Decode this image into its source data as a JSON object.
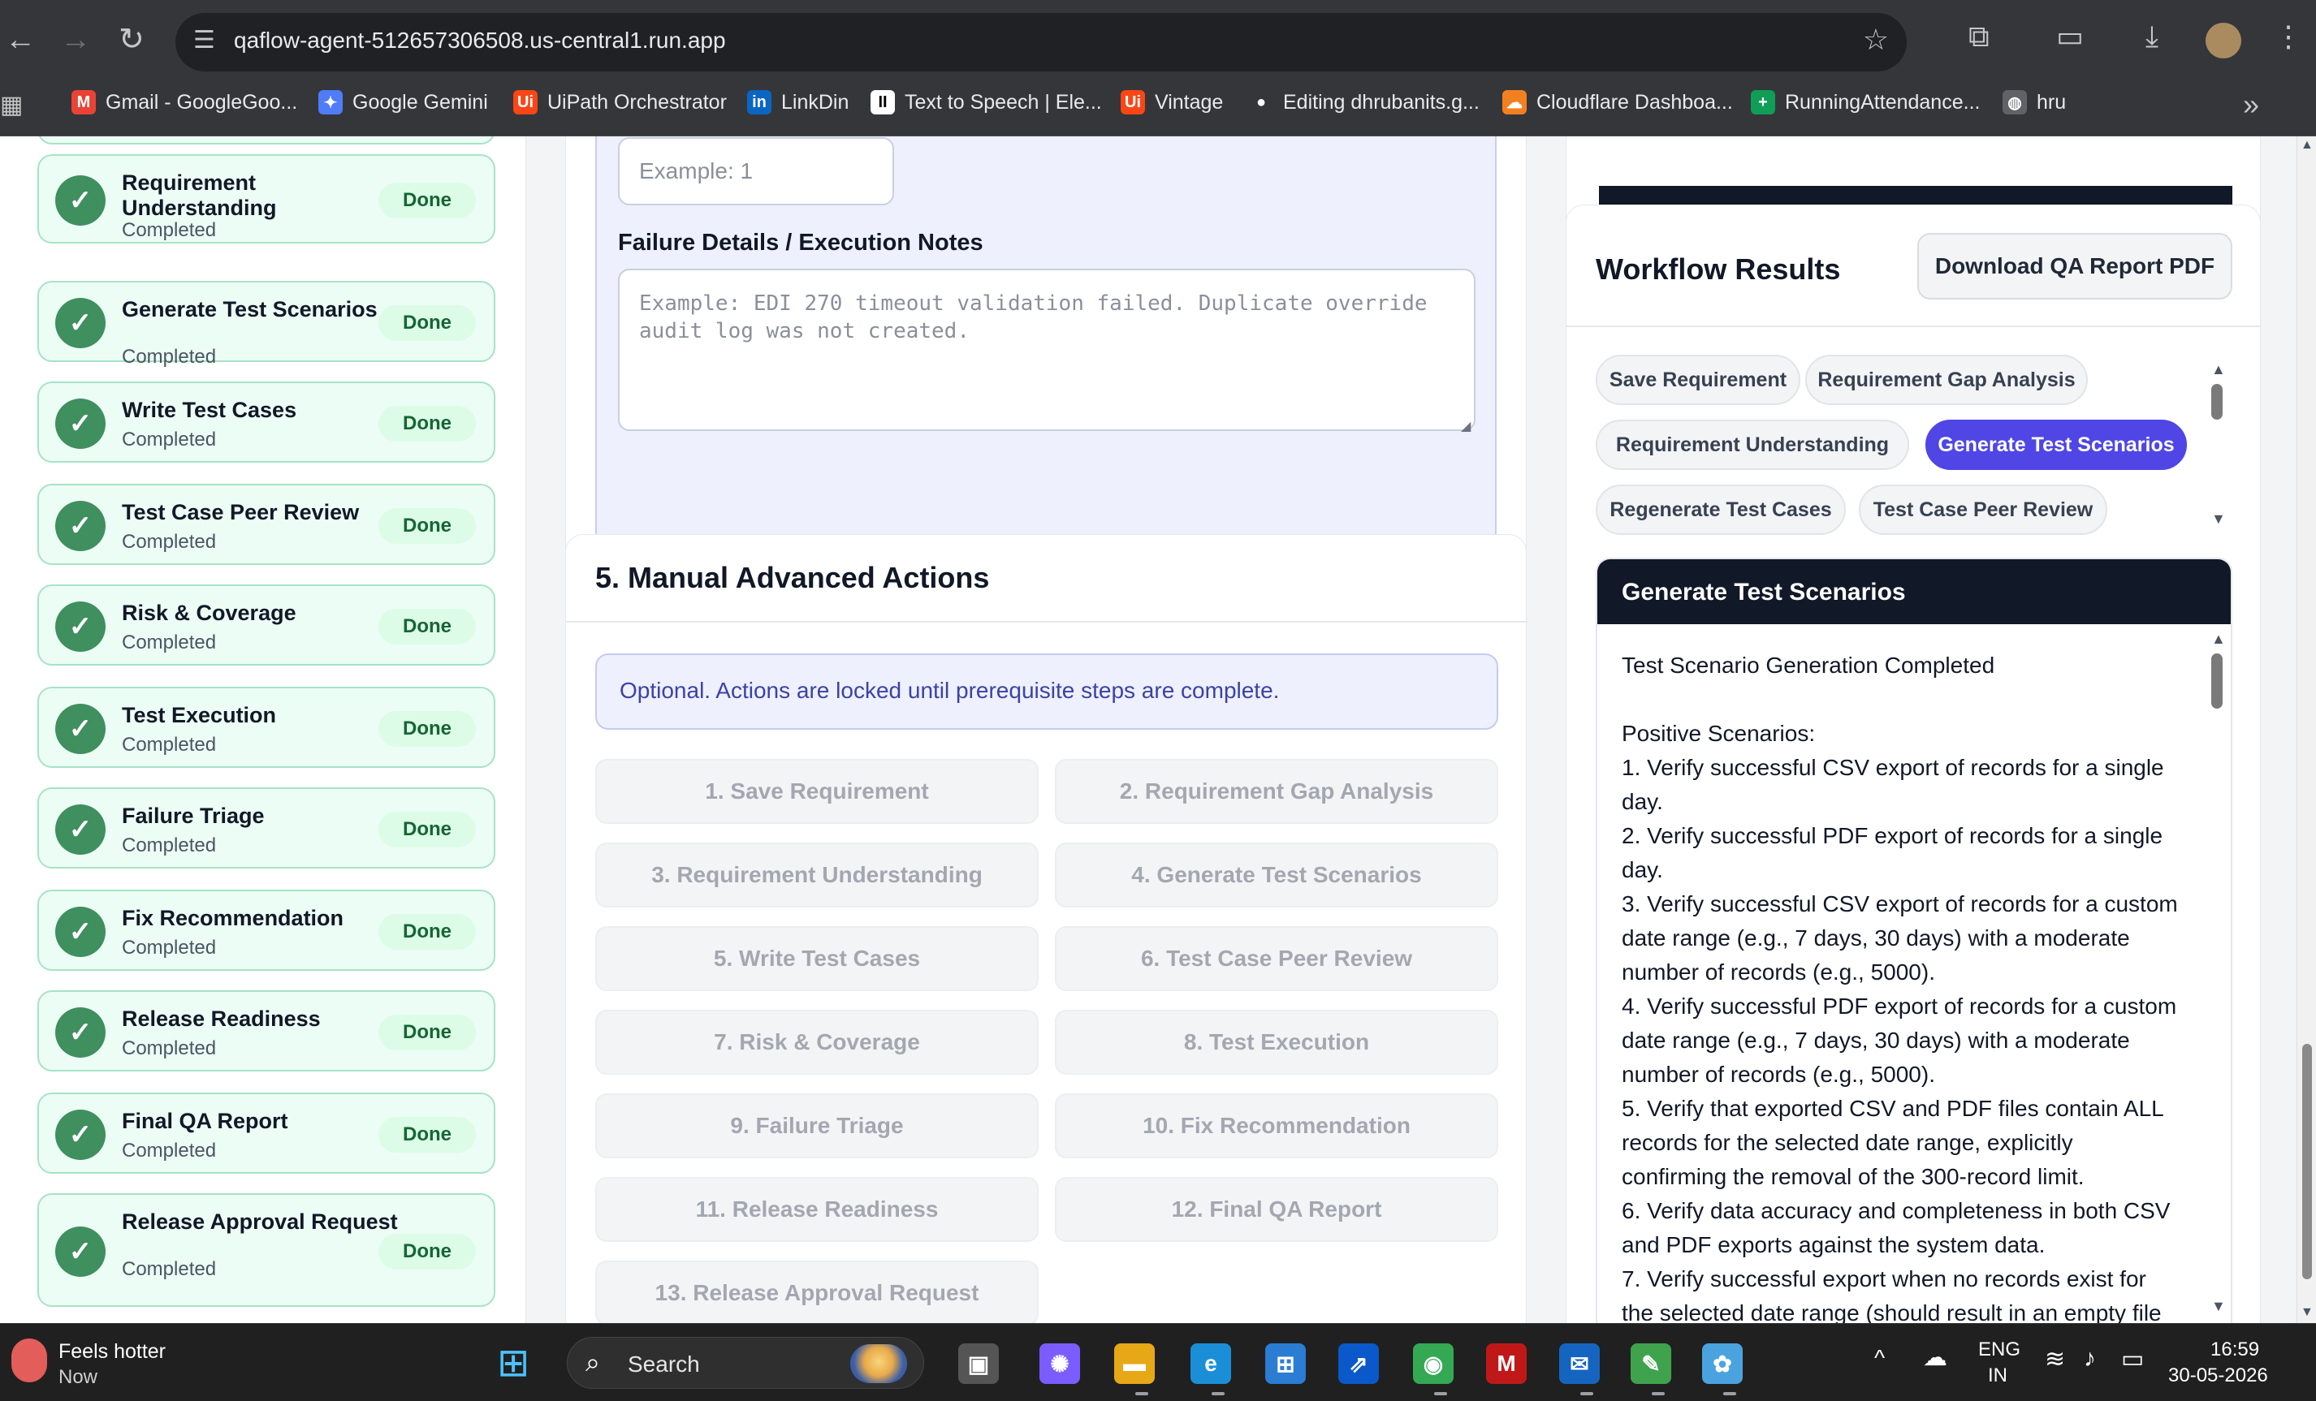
{
  "browser": {
    "url": "qaflow-agent-512657306508.us-central1.run.app",
    "bookmarks": [
      {
        "label": "Gmail - GoogleGoo...",
        "icon": "gmail-icon",
        "color": "#ea4335",
        "glyph": "M"
      },
      {
        "label": "Google Gemini",
        "icon": "gemini-icon",
        "color": "#4f7cf7",
        "glyph": "✦"
      },
      {
        "label": "UiPath Orchestrator",
        "icon": "uipath-icon",
        "color": "#fa4616",
        "glyph": "Ui"
      },
      {
        "label": "LinkDin",
        "icon": "linkedin-icon",
        "color": "#0a66c2",
        "glyph": "in"
      },
      {
        "label": "Text to Speech | Ele...",
        "icon": "elevenlabs-icon",
        "color": "#ffffff",
        "glyph": "II"
      },
      {
        "label": "Vintage",
        "icon": "uipath-icon",
        "color": "#fa4616",
        "glyph": "Ui"
      },
      {
        "label": "Editing dhrubanits.g...",
        "icon": "github-icon",
        "color": "#35363a",
        "glyph": "●"
      },
      {
        "label": "Cloudflare Dashboa...",
        "icon": "cloudflare-icon",
        "color": "#f38020",
        "glyph": "☁"
      },
      {
        "label": "RunningAttendance...",
        "icon": "sheets-icon",
        "color": "#0f9d58",
        "glyph": "+"
      },
      {
        "label": "hru",
        "icon": "globe-icon",
        "color": "#5f6368",
        "glyph": "◍"
      }
    ]
  },
  "sidebar": {
    "steps": [
      {
        "title": "Requirement Understanding",
        "status": "Completed",
        "badge": "Done"
      },
      {
        "title": "Generate Test Scenarios",
        "status": "Completed",
        "badge": "Done"
      },
      {
        "title": "Write Test Cases",
        "status": "Completed",
        "badge": "Done"
      },
      {
        "title": "Test Case Peer Review",
        "status": "Completed",
        "badge": "Done"
      },
      {
        "title": "Risk & Coverage",
        "status": "Completed",
        "badge": "Done"
      },
      {
        "title": "Test Execution",
        "status": "Completed",
        "badge": "Done"
      },
      {
        "title": "Failure Triage",
        "status": "Completed",
        "badge": "Done"
      },
      {
        "title": "Fix Recommendation",
        "status": "Completed",
        "badge": "Done"
      },
      {
        "title": "Release Readiness",
        "status": "Completed",
        "badge": "Done"
      },
      {
        "title": "Final QA Report",
        "status": "Completed",
        "badge": "Done"
      },
      {
        "title": "Release Approval Request",
        "status": "Completed",
        "badge": "Done"
      }
    ]
  },
  "execution_form": {
    "count_placeholder": "Example: 1",
    "notes_label": "Failure Details / Execution Notes",
    "notes_placeholder": "Example: EDI 270 timeout validation failed. Duplicate override audit log was not created."
  },
  "manual_actions": {
    "title": "5. Manual Advanced Actions",
    "notice": "Optional. Actions are locked until prerequisite steps are complete.",
    "buttons": [
      "1. Save Requirement",
      "2. Requirement Gap Analysis",
      "3. Requirement Understanding",
      "4. Generate Test Scenarios",
      "5. Write Test Cases",
      "6. Test Case Peer Review",
      "7. Risk & Coverage",
      "8. Test Execution",
      "9. Failure Triage",
      "10. Fix Recommendation",
      "11. Release Readiness",
      "12. Final QA Report",
      "13. Release Approval Request"
    ]
  },
  "results": {
    "title": "Workflow Results",
    "download_label": "Download QA Report PDF",
    "tabs": [
      {
        "label": "Save Requirement",
        "active": false
      },
      {
        "label": "Requirement Gap Analysis",
        "active": false
      },
      {
        "label": "Requirement Understanding",
        "active": false
      },
      {
        "label": "Generate Test Scenarios",
        "active": true
      },
      {
        "label": "Regenerate Test Cases",
        "active": false
      },
      {
        "label": "Test Case Peer Review",
        "active": false
      }
    ],
    "panel_title": "Generate Test Scenarios",
    "panel_text": "Test Scenario Generation Completed\n\nPositive Scenarios:\n1. Verify successful CSV export of records for a single day.\n2. Verify successful PDF export of records for a single day.\n3. Verify successful CSV export of records for a custom date range (e.g., 7 days, 30 days) with a moderate number of records (e.g., 5000).\n4. Verify successful PDF export of records for a custom date range (e.g., 7 days, 30 days) with a moderate number of records (e.g., 5000).\n5. Verify that exported CSV and PDF files contain ALL records for the selected date range, explicitly confirming the removal of the 300-record limit.\n6. Verify data accuracy and completeness in both CSV and PDF exports against the system data.\n7. Verify successful export when no records exist for the selected date range (should result in an empty file"
  },
  "taskbar": {
    "weather_title": "Feels hotter",
    "weather_sub": "Now",
    "search_label": "Search",
    "lang_top": "ENG",
    "lang_bottom": "IN",
    "time": "16:59",
    "date": "30-05-2026"
  }
}
